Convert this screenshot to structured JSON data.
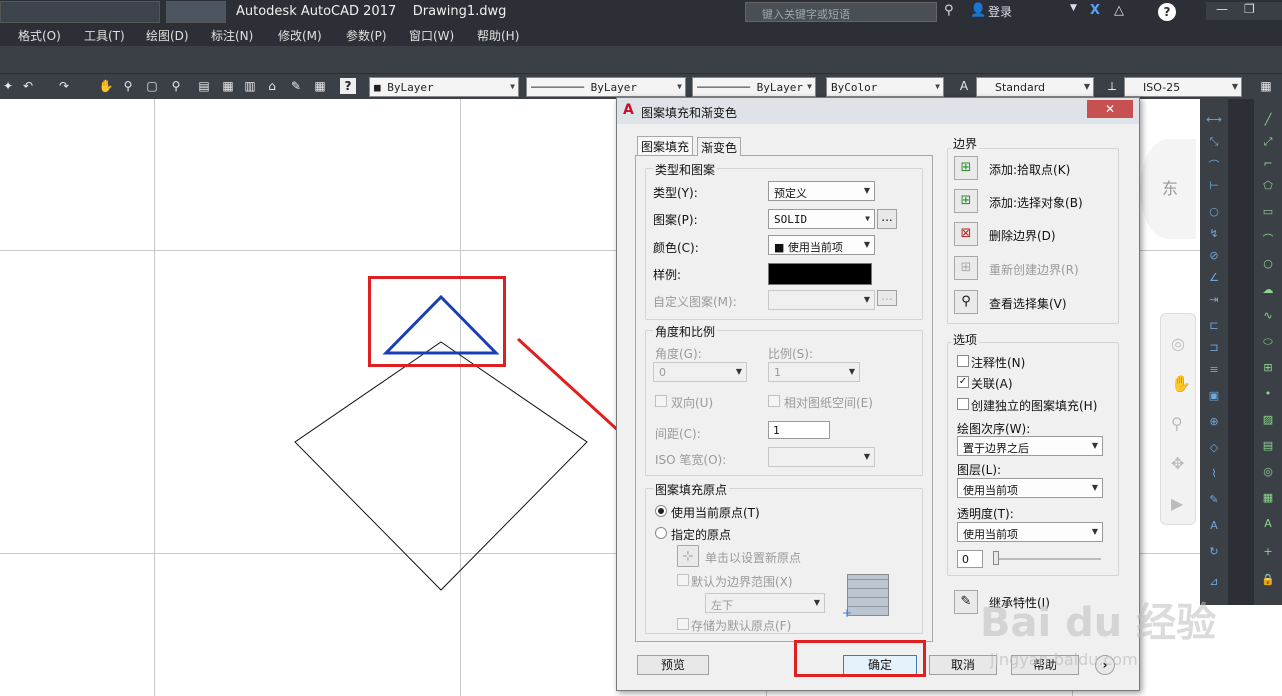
{
  "titlebar": {
    "app_title": "Autodesk AutoCAD 2017",
    "file_name": "Drawing1.dwg",
    "search_placeholder": "键入关键字或短语",
    "login": "登录",
    "help_icon": "?"
  },
  "menu": [
    "格式(O)",
    "工具(T)",
    "绘图(D)",
    "标注(N)",
    "修改(M)",
    "参数(P)",
    "窗口(W)",
    "帮助(H)"
  ],
  "toolbar": {
    "color_combo": "ByLayer",
    "linetype_combo": "ByLayer",
    "lineweight_combo": "ByLayer",
    "plotstyle_combo": "ByColor",
    "text_style": "Standard",
    "dim_style": "ISO-25"
  },
  "canvas": {
    "compass_label": "东"
  },
  "dialog": {
    "title": "图案填充和渐变色",
    "tabs": [
      "图案填充",
      "渐变色"
    ],
    "type_pattern": {
      "group": "类型和图案",
      "type_label": "类型(Y):",
      "type_value": "预定义",
      "pattern_label": "图案(P):",
      "pattern_value": "SOLID",
      "color_label": "颜色(C):",
      "color_value": "■ 使用当前项",
      "sample_label": "样例:",
      "custom_label": "自定义图案(M):",
      "browse": "..."
    },
    "angle_scale": {
      "group": "角度和比例",
      "angle_label": "角度(G):",
      "angle_value": "0",
      "scale_label": "比例(S):",
      "scale_value": "1",
      "double_label": "双向(U)",
      "relative_label": "相对图纸空间(E)",
      "spacing_label": "间距(C):",
      "spacing_value": "1",
      "iso_label": "ISO 笔宽(O):"
    },
    "origin": {
      "group": "图案填充原点",
      "use_current": "使用当前原点(T)",
      "specified": "指定的原点",
      "click_set": "单击以设置新原点",
      "default_boundary": "默认为边界范围(X)",
      "position_value": "左下",
      "store_default": "存储为默认原点(F)"
    },
    "boundary": {
      "group": "边界",
      "add_pick": "添加:拾取点(K)",
      "add_select": "添加:选择对象(B)",
      "remove": "删除边界(D)",
      "recreate": "重新创建边界(R)",
      "view_selection": "查看选择集(V)"
    },
    "options": {
      "group": "选项",
      "annotative": "注释性(N)",
      "associative": "关联(A)",
      "separate": "创建独立的图案填充(H)",
      "draw_order_label": "绘图次序(W):",
      "draw_order_value": "置于边界之后",
      "layer_label": "图层(L):",
      "layer_value": "使用当前项",
      "transparency_label": "透明度(T):",
      "transparency_value": "使用当前项",
      "transparency_num": "0"
    },
    "inherit": "继承特性(I)",
    "buttons": {
      "preview": "预览",
      "ok": "确定",
      "cancel": "取消",
      "help": "帮助",
      "more": "›"
    }
  },
  "watermark": {
    "brand": "Bai du 经验",
    "url": "jingyan.baidu.com"
  }
}
